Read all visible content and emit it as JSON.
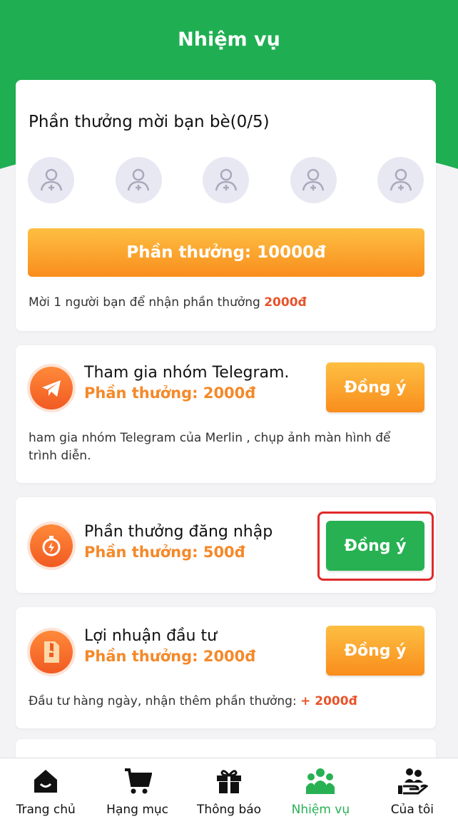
{
  "header": {
    "title": "Nhiệm vụ"
  },
  "invite": {
    "title": "Phần thưởng mời bạn bè(0/5)",
    "avatar_count": 5,
    "reward_button": "Phần thưởng: 10000đ",
    "note_prefix": "Mời 1 người bạn để nhận phần thưởng ",
    "note_amount": "2000đ"
  },
  "tasks": [
    {
      "title": "Tham gia nhóm Telegram.",
      "reward": "Phần thưởng: 2000đ",
      "button": "Đồng ý",
      "icon": "telegram-icon",
      "description": "ham gia nhóm Telegram của Merlin , chụp ảnh màn hình để trình diễn."
    },
    {
      "title": "Phần thưởng đăng nhập",
      "reward": "Phần thưởng: 500đ",
      "button": "Đồng ý",
      "icon": "stopwatch-icon"
    },
    {
      "title": "Lợi nhuận đầu tư",
      "reward": "Phần thưởng: 2000đ",
      "button": "Đồng ý",
      "icon": "zip-file-icon",
      "description_prefix": "Đầu tư hàng ngày, nhận thêm phần thưởng: ",
      "description_amount": "+ 2000đ"
    }
  ],
  "colors": {
    "primary_green": "#1faf52",
    "orange": "#f98d1d",
    "highlight_red": "#e02a2a"
  },
  "tabbar": {
    "items": [
      {
        "label": "Trang chủ",
        "icon": "home-icon"
      },
      {
        "label": "Hạng mục",
        "icon": "cart-icon"
      },
      {
        "label": "Thông báo",
        "icon": "gift-icon"
      },
      {
        "label": "Nhiệm vụ",
        "icon": "people-icon",
        "active": true
      },
      {
        "label": "Của tôi",
        "icon": "hand-users-icon"
      }
    ]
  }
}
